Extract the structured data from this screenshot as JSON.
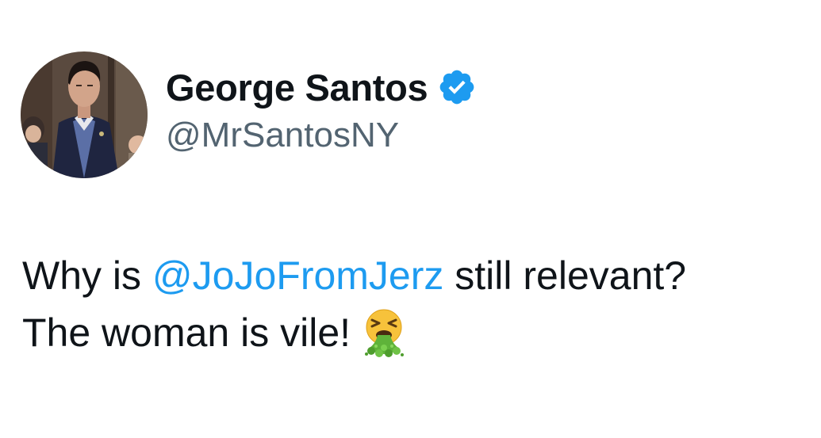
{
  "tweet": {
    "author": {
      "display_name": "George Santos",
      "handle": "@MrSantosNY",
      "verified_icon": "verified-badge-icon"
    },
    "text": {
      "line1_prefix": "Why is ",
      "mention": "@JoJoFromJerz",
      "line1_suffix": " still relevant?",
      "line2": "The woman is vile!",
      "emoji_icon": "vomiting-face-emoji"
    }
  },
  "colors": {
    "text": "#0f1419",
    "secondary": "#536471",
    "link": "#1d9bf0",
    "verified": "#1d9bf0",
    "background": "#ffffff"
  }
}
